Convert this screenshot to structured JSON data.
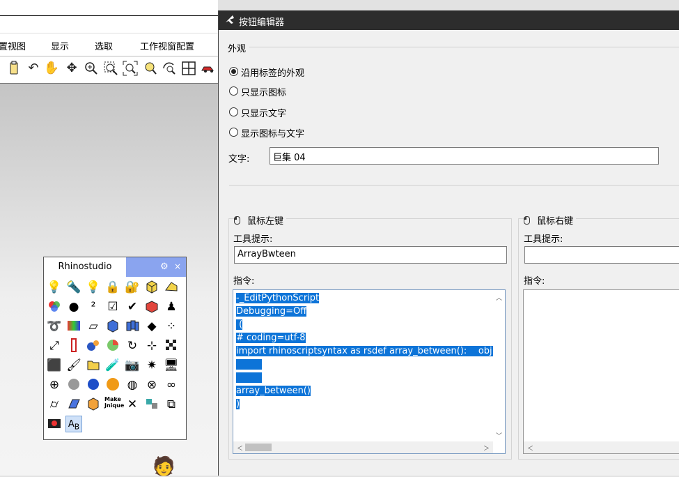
{
  "background": {
    "menu": [
      "置视图",
      "显示",
      "选取",
      "工作视窗配置"
    ],
    "toolbar_icons": [
      "clipboard-icon",
      "undo-icon",
      "pan-hand-icon",
      "rotate-view-icon",
      "zoom-in-icon",
      "zoom-window-icon",
      "zoom-extents-icon",
      "zoom-selected-icon",
      "rotate-camera-icon",
      "four-viewports-icon",
      "car-icon"
    ],
    "palette": {
      "tab": "Rhinostudio",
      "gear": "⚙",
      "close": "×",
      "make_unique_label": "Make Jnique"
    }
  },
  "dialog": {
    "title": "按钮编辑器",
    "appearance_label": "外观",
    "radios": [
      {
        "label": "沿用标签的外观",
        "selected": true
      },
      {
        "label": "只显示图标",
        "selected": false
      },
      {
        "label": "只显示文字",
        "selected": false
      },
      {
        "label": "显示图标与文字",
        "selected": false
      }
    ],
    "text_label": "文字:",
    "text_value": "巨集 04",
    "left": {
      "group_title": "鼠标左键",
      "tooltip_label": "工具提示:",
      "tooltip_value": "ArrayBwteen",
      "command_label": "指令:",
      "command_lines": [
        "-_EditPythonScript",
        "Debugging=Off",
        " (",
        "# coding=utf-8",
        "import rhinoscriptsyntax as rsdef array_between():    obj = ",
        "         ",
        "         ",
        "array_between()",
        ")"
      ]
    },
    "right": {
      "group_title": "鼠标右键",
      "tooltip_label": "工具提示:",
      "tooltip_value": "",
      "command_label": "指令:"
    }
  }
}
